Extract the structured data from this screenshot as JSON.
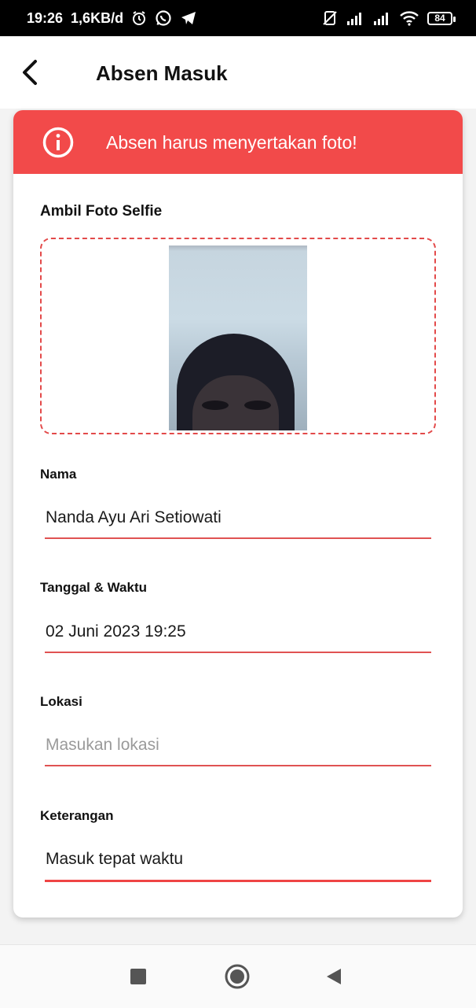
{
  "status_bar": {
    "time": "19:26",
    "network_speed": "1,6KB/d",
    "battery": "84",
    "icons": [
      "alarm-icon",
      "whatsapp-icon",
      "telegram-icon",
      "no-sim-icon",
      "signal-icon",
      "signal-icon",
      "wifi-icon",
      "battery-icon"
    ]
  },
  "app_bar": {
    "title": "Absen Masuk",
    "back_icon": "chevron-left-icon"
  },
  "alert": {
    "icon": "info-icon",
    "message": "Absen harus menyertakan foto!",
    "color": "#f24a4a"
  },
  "photo_section": {
    "label": "Ambil Foto Selfie"
  },
  "form": {
    "nama": {
      "label": "Nama",
      "value": "Nanda Ayu Ari Setiowati"
    },
    "tanggal": {
      "label": "Tanggal & Waktu",
      "value": "02 Juni 2023 19:25"
    },
    "lokasi": {
      "label": "Lokasi",
      "value": "",
      "placeholder": "Masukan lokasi"
    },
    "keterangan": {
      "label": "Keterangan",
      "value": "Masuk tepat waktu"
    }
  },
  "nav_bar": {
    "icons": [
      "recents-square-icon",
      "home-circle-icon",
      "back-triangle-icon"
    ]
  },
  "colors": {
    "accent": "#ef4444",
    "status_bar": "#000000"
  }
}
